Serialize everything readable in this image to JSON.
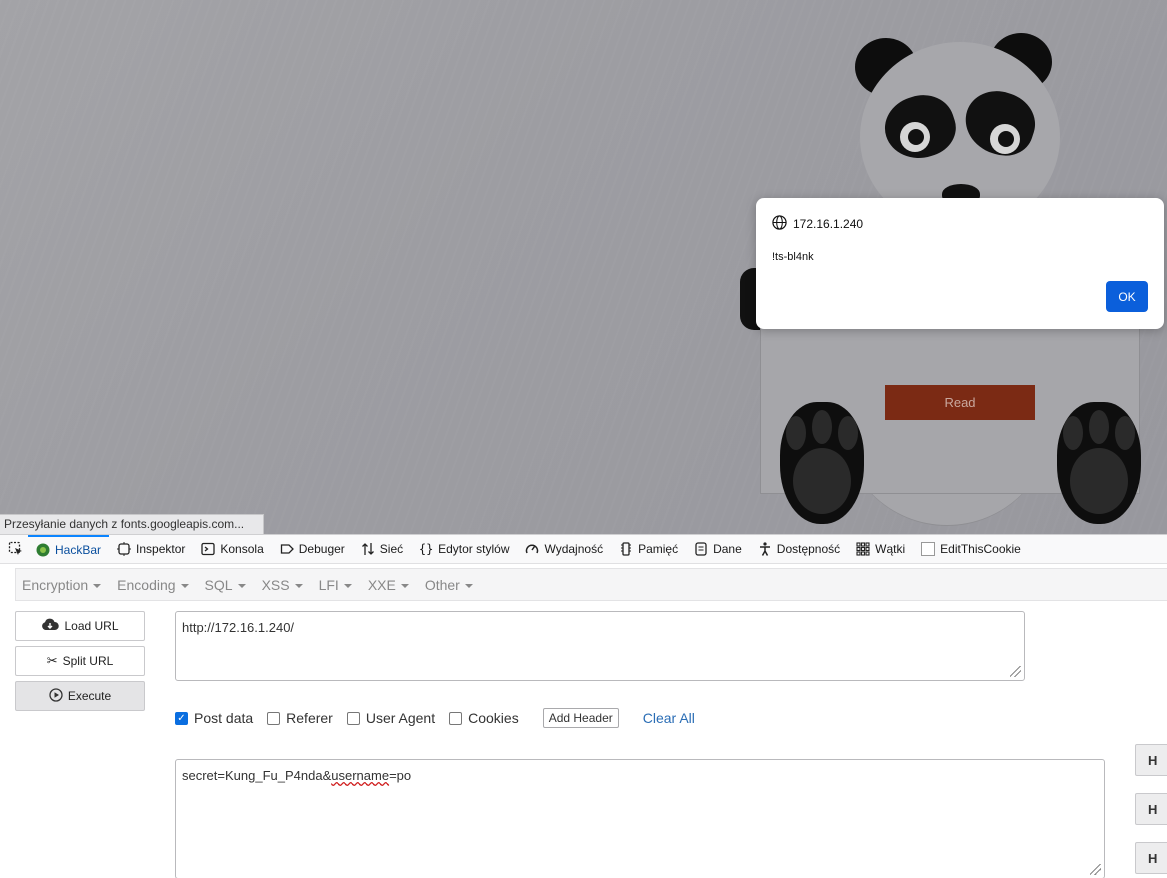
{
  "dialog": {
    "origin": "172.16.1.240",
    "message": "!ts-bl4nk",
    "ok_label": "OK"
  },
  "page": {
    "read_button": "Read",
    "status": "Przesyłanie danych z fonts.googleapis.com..."
  },
  "devtools": {
    "tabs": [
      {
        "label": "HackBar",
        "icon": "hackbar-icon"
      },
      {
        "label": "Inspektor",
        "icon": "inspector-icon"
      },
      {
        "label": "Konsola",
        "icon": "console-icon"
      },
      {
        "label": "Debuger",
        "icon": "debugger-icon"
      },
      {
        "label": "Sieć",
        "icon": "network-icon"
      },
      {
        "label": "Edytor stylów",
        "icon": "style-editor-icon"
      },
      {
        "label": "Wydajność",
        "icon": "performance-icon"
      },
      {
        "label": "Pamięć",
        "icon": "memory-icon"
      },
      {
        "label": "Dane",
        "icon": "storage-icon"
      },
      {
        "label": "Dostępność",
        "icon": "accessibility-icon"
      },
      {
        "label": "Wątki",
        "icon": "threads-icon"
      },
      {
        "label": "EditThisCookie",
        "icon": "cookie-icon"
      }
    ]
  },
  "hackbar": {
    "menus": [
      "Encryption",
      "Encoding",
      "SQL",
      "XSS",
      "LFI",
      "XXE",
      "Other"
    ],
    "load_url": "Load URL",
    "split_url": "Split URL",
    "execute": "Execute",
    "url_value": "http://172.16.1.240/",
    "options": {
      "post_data": "Post data",
      "referer": "Referer",
      "user_agent": "User Agent",
      "cookies": "Cookies",
      "add_header": "Add Header",
      "clear_all": "Clear All"
    },
    "post_prefix": "secret=Kung_Fu_P4nda&",
    "post_misspelled": "username",
    "post_suffix": "=po",
    "header_button": "H",
    "accent_color": "#0a6ee0"
  }
}
